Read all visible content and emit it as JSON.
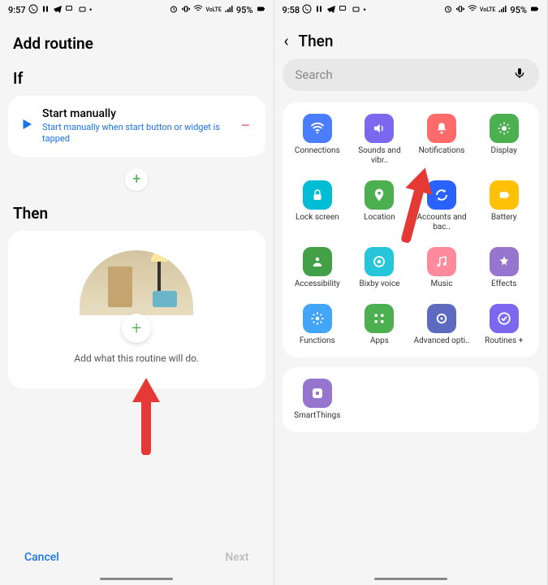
{
  "left": {
    "status": {
      "time": "9:57",
      "battery": "95%",
      "lte": "VoLTE"
    },
    "title": "Add routine",
    "ifTitle": "If",
    "ifItem": {
      "title": "Start manually",
      "subtitle": "Start manually when start button or widget is tapped"
    },
    "thenTitle": "Then",
    "thenHint": "Add what this routine will do.",
    "cancel": "Cancel",
    "next": "Next"
  },
  "right": {
    "status": {
      "time": "9:58",
      "battery": "95%",
      "lte": "VoLTE"
    },
    "title": "Then",
    "searchPlaceholder": "Search",
    "items": [
      {
        "label": "Connections",
        "icon": "wifi",
        "color": "bg-blue"
      },
      {
        "label": "Sounds and vibr..",
        "icon": "sound",
        "color": "bg-purple"
      },
      {
        "label": "Notifications",
        "icon": "bell",
        "color": "bg-coral"
      },
      {
        "label": "Display",
        "icon": "sun",
        "color": "bg-green"
      },
      {
        "label": "Lock screen",
        "icon": "lock",
        "color": "bg-teal"
      },
      {
        "label": "Location",
        "icon": "pin",
        "color": "bg-green"
      },
      {
        "label": "Accounts and bac..",
        "icon": "sync",
        "color": "bg-dblue"
      },
      {
        "label": "Battery",
        "icon": "battery",
        "color": "bg-yellow"
      },
      {
        "label": "Accessibility",
        "icon": "person",
        "color": "bg-darkgreen"
      },
      {
        "label": "Bixby voice",
        "icon": "bixby",
        "color": "bg-cyan"
      },
      {
        "label": "Music",
        "icon": "music",
        "color": "bg-pink"
      },
      {
        "label": "Effects",
        "icon": "effects",
        "color": "bg-violet"
      },
      {
        "label": "Functions",
        "icon": "gear",
        "color": "bg-lightblue"
      },
      {
        "label": "Apps",
        "icon": "apps",
        "color": "bg-green"
      },
      {
        "label": "Advanced opti..",
        "icon": "advanced",
        "color": "bg-indigo"
      },
      {
        "label": "Routines +",
        "icon": "check",
        "color": "bg-purple"
      }
    ],
    "extra": [
      {
        "label": "SmartThings",
        "icon": "smart",
        "color": "bg-violet"
      }
    ]
  }
}
